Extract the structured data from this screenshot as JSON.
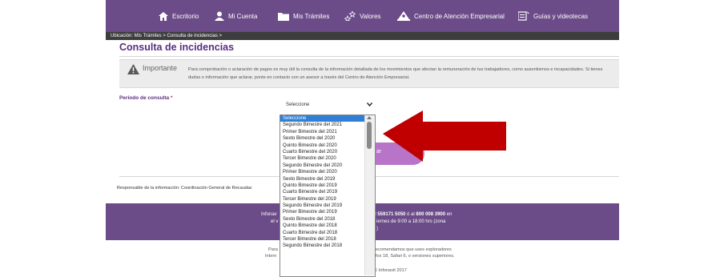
{
  "nav": {
    "items": [
      {
        "label": "Escritorio",
        "icon": "home-icon"
      },
      {
        "label": "Mi Cuenta",
        "icon": "user-icon"
      },
      {
        "label": "Mis Trámites",
        "icon": "folder-icon"
      },
      {
        "label": "Valores",
        "icon": "stars-icon"
      },
      {
        "label": "Centro de Atención Empresarial",
        "icon": "service-center-icon"
      },
      {
        "label": "Guías y videotecas",
        "icon": "guide-icon"
      }
    ]
  },
  "breadcrumb": "Ubicación: Mis Trámites > Consulta de incidencias >",
  "page_title": "Consulta de incidencias",
  "important": {
    "label": "Importante",
    "text": "Para comprobación o aclaración de pagos es muy útil la consulta de la información detallada de los movimientos que afectan la remuneración de tus trabajadores, como ausentismos e incapacidades. Si tienes dudas o información que aclarar, ponte en contacto con un asesor a través del Centro de Atención Empresarial."
  },
  "form": {
    "periodo_label": "Periodo de consulta",
    "required_mark": "*",
    "select_value": "Seleccione",
    "button_fragment": "ar",
    "options": [
      "Seleccione",
      "Segundo Bimestre del 2021",
      "Primer Bimestre del 2021",
      "Sexto Bimestre del 2020",
      "Quinto Bimestre del 2020",
      "Cuarto Bimestre del 2020",
      "Tercer Bimestre del 2020",
      "Segundo Bimestre del 2020",
      "Primer Bimestre del 2020",
      "Sexto Bimestre del 2019",
      "Quinto Bimestre del 2019",
      "Cuarto Bimestre del 2019",
      "Tercer Bimestre del 2019",
      "Segundo Bimestre del 2019",
      "Primer Bimestre del 2019",
      "Sexto Bimestre del 2018",
      "Quinto Bimestre del 2018",
      "Cuarto Bimestre del 2018",
      "Tercer Bimestre del 2018",
      "Segundo Bimestre del 2018"
    ]
  },
  "responsable": "Responsable de la información: Coordinación General de Recaudac",
  "footer": {
    "left1": "Infonav",
    "left2": "el v",
    "right1_pre": "al ",
    "phone1": "559171 5050",
    "right1_mid": " ó al ",
    "phone2": "800 008 3900",
    "right1_post": " en",
    "right2": "iernes de 9:00 a 18:00 hrs (zona",
    "right3": ")"
  },
  "bottom": {
    "l1": "Para",
    "l2": "Intern",
    "r1": "ecomendamos que uses exploradores",
    "r2": "fox 18, Safari 6, o versiones superiores.",
    "r3": "© Infonavit 2017"
  },
  "colors": {
    "nav": "#6b4b88",
    "accent": "#5b2d82",
    "arrow": "#c00000",
    "selected": "#2f7fd6"
  }
}
